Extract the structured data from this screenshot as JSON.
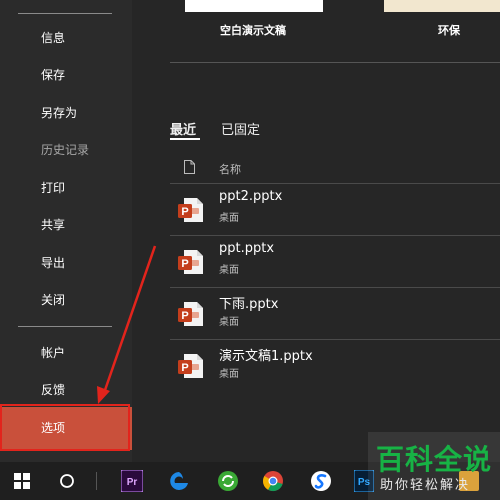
{
  "sidebar": {
    "items": [
      {
        "label": "信息"
      },
      {
        "label": "保存"
      },
      {
        "label": "另存为"
      },
      {
        "label": "历史记录"
      },
      {
        "label": "打印"
      },
      {
        "label": "共享"
      },
      {
        "label": "导出"
      },
      {
        "label": "关闭"
      },
      {
        "label": "帐户"
      },
      {
        "label": "反馈"
      },
      {
        "label": "选项"
      }
    ]
  },
  "templates": [
    {
      "label": "空白演示文稿"
    },
    {
      "label": "环保"
    }
  ],
  "tabs": [
    {
      "label": "最近"
    },
    {
      "label": "已固定"
    }
  ],
  "file_list": {
    "column_name": "名称",
    "files": [
      {
        "name": "ppt2.pptx",
        "location": "桌面"
      },
      {
        "name": "ppt.pptx",
        "location": "桌面"
      },
      {
        "name": "下雨.pptx",
        "location": "桌面"
      },
      {
        "name": "演示文稿1.pptx",
        "location": "桌面"
      }
    ],
    "icon_badge": "P"
  },
  "taskbar": {
    "premiere_label": "Pr",
    "photoshop_label": "Ps"
  },
  "watermark": {
    "title": "百科全说",
    "subtitle": "助你轻松解决"
  },
  "colors": {
    "accent": "#c9503b",
    "highlight_border": "#e2241c",
    "ppt_red": "#c43e1c",
    "watermark_green": "#17b345"
  }
}
